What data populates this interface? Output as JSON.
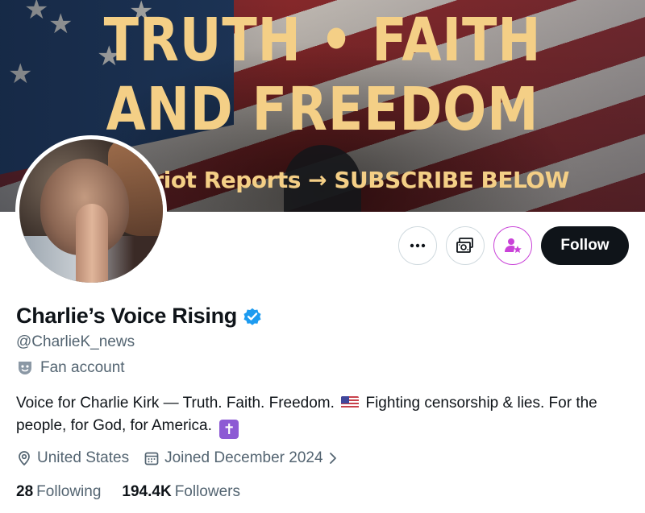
{
  "banner": {
    "headline_line1": "TRUTH • FAITH",
    "headline_line2": "AND FREEDOM",
    "tagline": "lusive Patriot Reports → SUBSCRIBE BELOW",
    "text_color": "#f4cf86"
  },
  "actions": {
    "more_icon": "more-horizontal-icon",
    "subscribe_icon": "subscription-money-icon",
    "notify_icon": "person-star-icon",
    "follow_label": "Follow"
  },
  "profile": {
    "display_name": "Charlie’s Voice Rising",
    "verified_icon": "verified-badge-icon",
    "verified_color": "#1d9bf0",
    "handle": "@CharlieK_news",
    "account_label": "Fan account",
    "bio_part1": "Voice for Charlie Kirk — Truth. Faith. Freedom.",
    "bio_flag_icon": "us-flag-emoji",
    "bio_part2": "Fighting censorship & lies. For the people, for God, for America.",
    "bio_cross_icon": "latin-cross-emoji",
    "location": "United States",
    "joined": "Joined December 2024"
  },
  "stats": {
    "following_count": "28",
    "following_label": "Following",
    "followers_count": "194.4K",
    "followers_label": "Followers"
  }
}
